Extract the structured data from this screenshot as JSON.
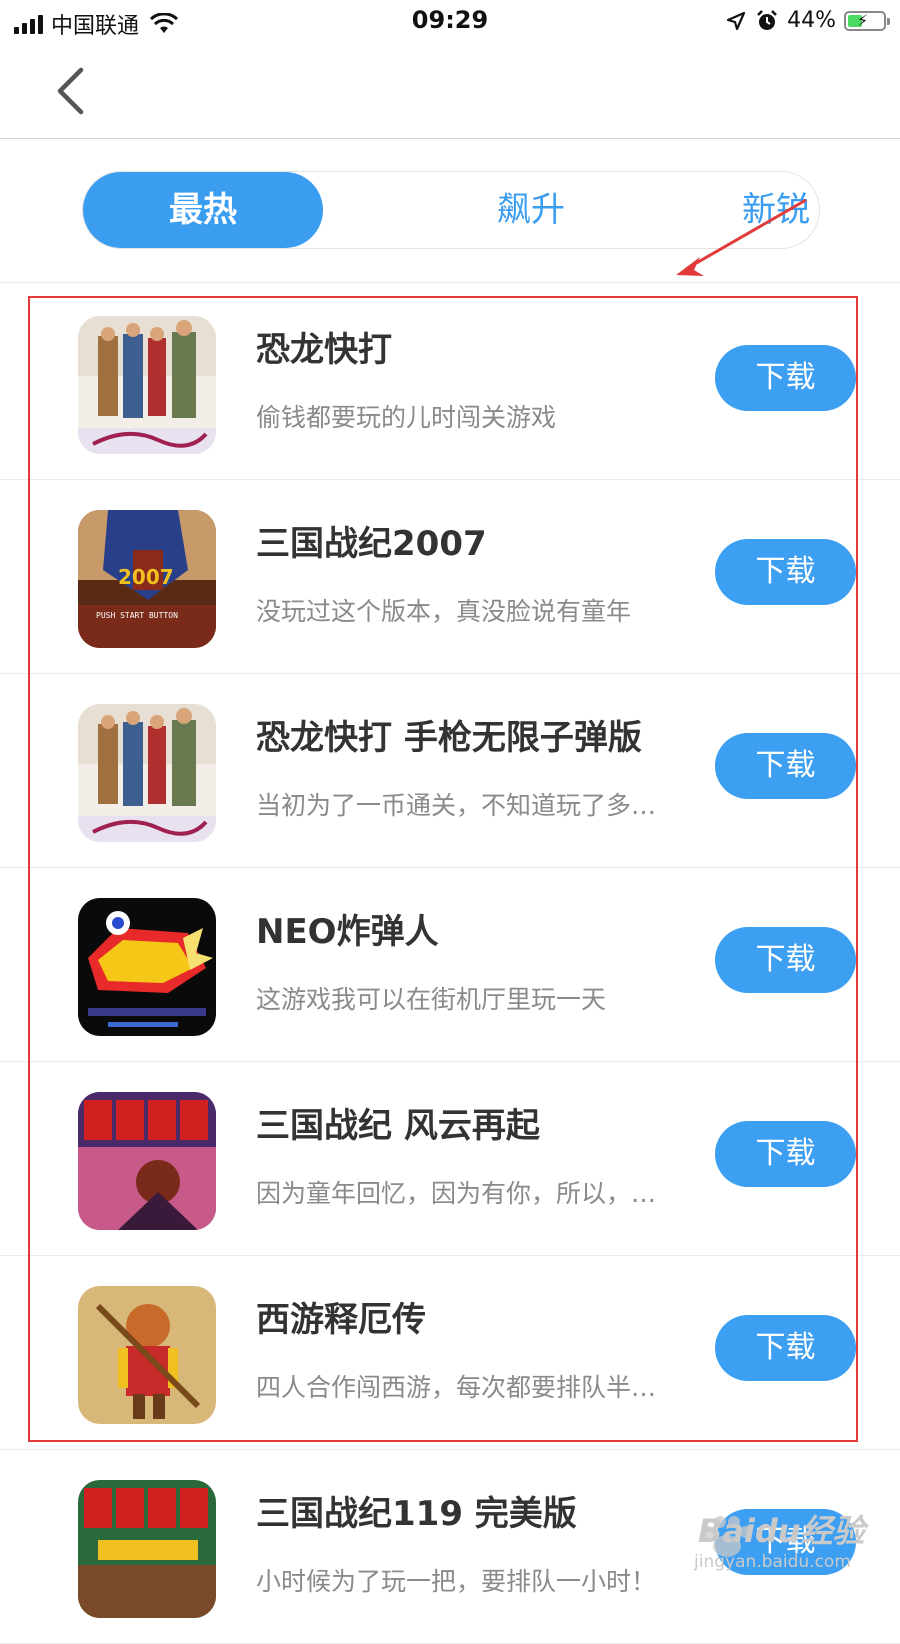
{
  "status_bar": {
    "carrier": "中国联通",
    "time": "09:29",
    "battery": "44%",
    "battery_level": 0.44
  },
  "tabs": [
    {
      "label": "最热",
      "active": true
    },
    {
      "label": "飙升",
      "active": false
    },
    {
      "label": "新锐",
      "active": false
    }
  ],
  "download_label": "下载",
  "items": [
    {
      "title": "恐龙快打",
      "desc": "偷钱都要玩的儿时闯关游戏"
    },
    {
      "title": "三国战纪2007",
      "desc": "没玩过这个版本，真没脸说有童年"
    },
    {
      "title": "恐龙快打 手枪无限子弹版",
      "desc": "当初为了一币通关，不知道玩了多…"
    },
    {
      "title": "NEO炸弹人",
      "desc": "这游戏我可以在街机厅里玩一天"
    },
    {
      "title": "三国战纪 风云再起",
      "desc": "因为童年回忆，因为有你，所以，…"
    },
    {
      "title": "西游释厄传",
      "desc": "四人合作闯西游，每次都要排队半…"
    },
    {
      "title": "三国战纪119 完美版",
      "desc": "小时候为了玩一把，要排队一小时！"
    }
  ],
  "watermark": {
    "brand": "Baidu经验",
    "url": "jingyan.baidu.com"
  },
  "colors": {
    "accent": "#3a9df0",
    "annotation": "#e23a3a"
  }
}
